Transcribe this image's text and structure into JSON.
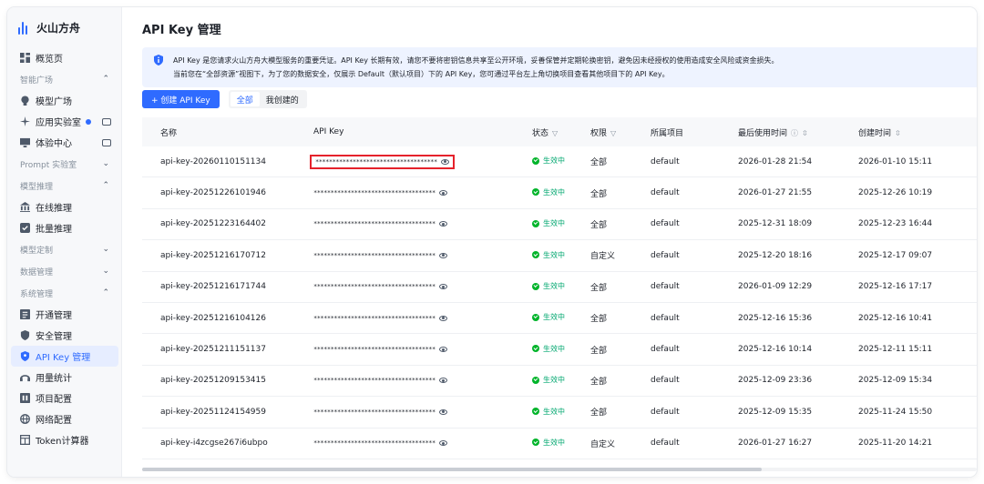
{
  "brand": {
    "name": "火山方舟",
    "logo_color": "#2f6bff"
  },
  "sidebar": {
    "overview": "概览页",
    "groups": {
      "smart_square": "智能广场",
      "prompt_lab": "Prompt 实验室",
      "model_inference": "模型推理",
      "model_custom": "模型定制",
      "data_mgmt": "数据管理",
      "system_mgmt": "系统管理"
    },
    "items": {
      "model_square": "模型广场",
      "app_lab": "应用实验室",
      "experience": "体验中心",
      "online_inference": "在线推理",
      "batch_inference": "批量推理",
      "activation": "开通管理",
      "security": "安全管理",
      "api_key": "API Key 管理",
      "usage": "用量统计",
      "project": "项目配置",
      "network": "网络配置",
      "token_calc": "Token计算器"
    }
  },
  "page": {
    "title": "API Key 管理",
    "notice_line1": "API Key 是您请求火山方舟大模型服务的重要凭证。API Key 长期有效，请您不要将密钥信息共享至公开环境，妥善保管并定期轮换密钥，避免因未经授权的使用造成安全风险或资金损失。",
    "notice_line2": "当前您在“全部资源”视图下，为了您的数据安全，仅展示 Default（默认项目）下的 API Key，您可通过平台左上角切换项目查看其他项目下的 API Key。",
    "create_button": "+ 创建 API Key",
    "tabs": [
      "全部",
      "我创建的"
    ]
  },
  "table": {
    "headers": {
      "name": "名称",
      "key": "API Key",
      "status": "状态",
      "perm": "权限",
      "project": "所属项目",
      "last_used": "最后使用时间",
      "created": "创建时间"
    },
    "masked_key": "************************************",
    "rows": [
      {
        "name": "api-key-20260110151134",
        "status": "生效中",
        "perm": "全部",
        "project": "default",
        "last_used": "2026-01-28 21:54",
        "created": "2026-01-10 15:11"
      },
      {
        "name": "api-key-20251226101946",
        "status": "生效中",
        "perm": "全部",
        "project": "default",
        "last_used": "2026-01-27 21:55",
        "created": "2025-12-26 10:19"
      },
      {
        "name": "api-key-20251223164402",
        "status": "生效中",
        "perm": "全部",
        "project": "default",
        "last_used": "2025-12-31 18:09",
        "created": "2025-12-23 16:44"
      },
      {
        "name": "api-key-20251216170712",
        "status": "生效中",
        "perm": "自定义",
        "project": "default",
        "last_used": "2025-12-20 18:16",
        "created": "2025-12-17 09:07"
      },
      {
        "name": "api-key-20251216171744",
        "status": "生效中",
        "perm": "全部",
        "project": "default",
        "last_used": "2026-01-09 12:29",
        "created": "2025-12-16 17:17"
      },
      {
        "name": "api-key-20251216104126",
        "status": "生效中",
        "perm": "全部",
        "project": "default",
        "last_used": "2025-12-16 15:36",
        "created": "2025-12-16 10:41"
      },
      {
        "name": "api-key-20251211151137",
        "status": "生效中",
        "perm": "全部",
        "project": "default",
        "last_used": "2025-12-16 10:14",
        "created": "2025-12-11 15:11"
      },
      {
        "name": "api-key-20251209153415",
        "status": "生效中",
        "perm": "全部",
        "project": "default",
        "last_used": "2025-12-09 23:36",
        "created": "2025-12-09 15:34"
      },
      {
        "name": "api-key-20251124154959",
        "status": "生效中",
        "perm": "全部",
        "project": "default",
        "last_used": "2025-12-09 15:35",
        "created": "2025-11-24 15:50"
      },
      {
        "name": "api-key-i4zcgse267i6ubpo",
        "status": "生效中",
        "perm": "自定义",
        "project": "default",
        "last_used": "2026-01-27 16:27",
        "created": "2025-11-20 14:21"
      }
    ]
  },
  "colors": {
    "accent": "#2f6bff",
    "status_ok": "#00b42a",
    "highlight": "#e5222b"
  }
}
